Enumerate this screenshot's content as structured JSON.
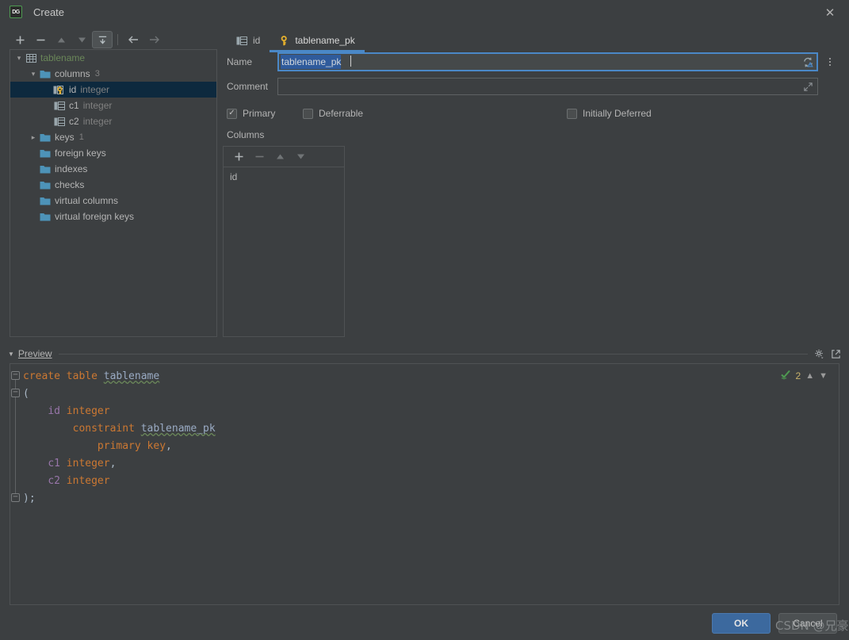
{
  "window": {
    "title": "Create",
    "app_icon": "datagrip-icon",
    "close_label": "✕"
  },
  "tree_toolbar": {
    "buttons": [
      {
        "name": "add-button",
        "glyph": "+",
        "enabled": true,
        "pressed": false
      },
      {
        "name": "remove-button",
        "glyph": "−",
        "enabled": true,
        "pressed": false
      },
      {
        "name": "move-up-button",
        "glyph": "▲",
        "enabled": false,
        "pressed": false
      },
      {
        "name": "move-down-button",
        "glyph": "▼",
        "enabled": false,
        "pressed": false
      },
      {
        "name": "jump-to-source-button",
        "glyph": "⤒",
        "enabled": true,
        "pressed": true
      },
      {
        "name": "navigate-back-button",
        "glyph": "←",
        "enabled": true,
        "pressed": false
      },
      {
        "name": "navigate-forward-button",
        "glyph": "→",
        "enabled": false,
        "pressed": false
      }
    ]
  },
  "tree": {
    "nodes": [
      {
        "label": "tablename",
        "kind": "table",
        "indent": 0,
        "twisty": "expanded",
        "icon": "table-icon",
        "type": "",
        "count": "",
        "selected": false
      },
      {
        "label": "columns",
        "kind": "folder",
        "indent": 1,
        "twisty": "expanded",
        "icon": "folder-icon",
        "type": "",
        "count": "3",
        "selected": false
      },
      {
        "label": "id",
        "kind": "column-pk",
        "indent": 2,
        "twisty": "none",
        "icon": "column-key-icon",
        "type": "integer",
        "count": "",
        "selected": true
      },
      {
        "label": "c1",
        "kind": "column",
        "indent": 2,
        "twisty": "none",
        "icon": "column-icon",
        "type": "integer",
        "count": "",
        "selected": false
      },
      {
        "label": "c2",
        "kind": "column",
        "indent": 2,
        "twisty": "none",
        "icon": "column-icon",
        "type": "integer",
        "count": "",
        "selected": false
      },
      {
        "label": "keys",
        "kind": "folder",
        "indent": 1,
        "twisty": "collapsed",
        "icon": "folder-icon",
        "type": "",
        "count": "1",
        "selected": false
      },
      {
        "label": "foreign keys",
        "kind": "folder",
        "indent": 1,
        "twisty": "none",
        "icon": "folder-icon",
        "type": "",
        "count": "",
        "selected": false
      },
      {
        "label": "indexes",
        "kind": "folder",
        "indent": 1,
        "twisty": "none",
        "icon": "folder-icon",
        "type": "",
        "count": "",
        "selected": false
      },
      {
        "label": "checks",
        "kind": "folder",
        "indent": 1,
        "twisty": "none",
        "icon": "folder-icon",
        "type": "",
        "count": "",
        "selected": false
      },
      {
        "label": "virtual columns",
        "kind": "folder",
        "indent": 1,
        "twisty": "none",
        "icon": "folder-icon",
        "type": "",
        "count": "",
        "selected": false
      },
      {
        "label": "virtual foreign keys",
        "kind": "folder",
        "indent": 1,
        "twisty": "none",
        "icon": "folder-icon",
        "type": "",
        "count": "",
        "selected": false
      }
    ]
  },
  "tabs": [
    {
      "label": "id",
      "icon": "column-icon",
      "active": false
    },
    {
      "label": "tablename_pk",
      "icon": "key-icon",
      "active": true
    }
  ],
  "form": {
    "name_label": "Name",
    "name_value": "tablename_pk",
    "name_selected": true,
    "name_field_icon": "refresh-warning-icon",
    "options_menu_icon": "vertical-dots-icon",
    "comment_label": "Comment",
    "comment_value": "",
    "comment_expand_icon": "expand-icon"
  },
  "checkboxes": [
    {
      "label": "Primary",
      "checked": true,
      "name": "primary-checkbox"
    },
    {
      "label": "Deferrable",
      "checked": false,
      "name": "deferrable-checkbox"
    },
    {
      "label": "Initially Deferred",
      "checked": false,
      "name": "initially-deferred-checkbox"
    }
  ],
  "columns_section": {
    "label": "Columns",
    "toolbar": [
      {
        "name": "columns-add-button",
        "glyph": "+",
        "enabled": true
      },
      {
        "name": "columns-remove-button",
        "glyph": "−",
        "enabled": false
      },
      {
        "name": "columns-move-up-button",
        "glyph": "▲",
        "enabled": false
      },
      {
        "name": "columns-move-down-button",
        "glyph": "▼",
        "enabled": false
      }
    ],
    "items": [
      "id"
    ]
  },
  "preview": {
    "title": "Preview",
    "collapse_icon": "triangle-down-icon",
    "settings_icon": "gear-icon",
    "popout_icon": "open-in-new-window-icon",
    "inspection": {
      "status_icon": "green-check-icon",
      "count": "2",
      "prev_icon": "chevron-up-icon",
      "next_icon": "chevron-down-icon"
    },
    "sql_lines": [
      "create table tablename",
      "(",
      "    id integer",
      "        constraint tablename_pk",
      "            primary key,",
      "    c1 integer,",
      "    c2 integer",
      ");"
    ]
  },
  "footer": {
    "ok_label": "OK",
    "cancel_label": "Cancel",
    "watermark": "CSDN @兄豪"
  },
  "colors": {
    "background": "#3c3f41",
    "selection": "#0d293e",
    "accent": "#4a88c7",
    "ok_button": "#3c699e",
    "table_name": "#6a8759",
    "keyword": "#cc7832",
    "identifier": "#9aabc4",
    "column": "#9876aa",
    "key_icon": "#e8b22c"
  }
}
